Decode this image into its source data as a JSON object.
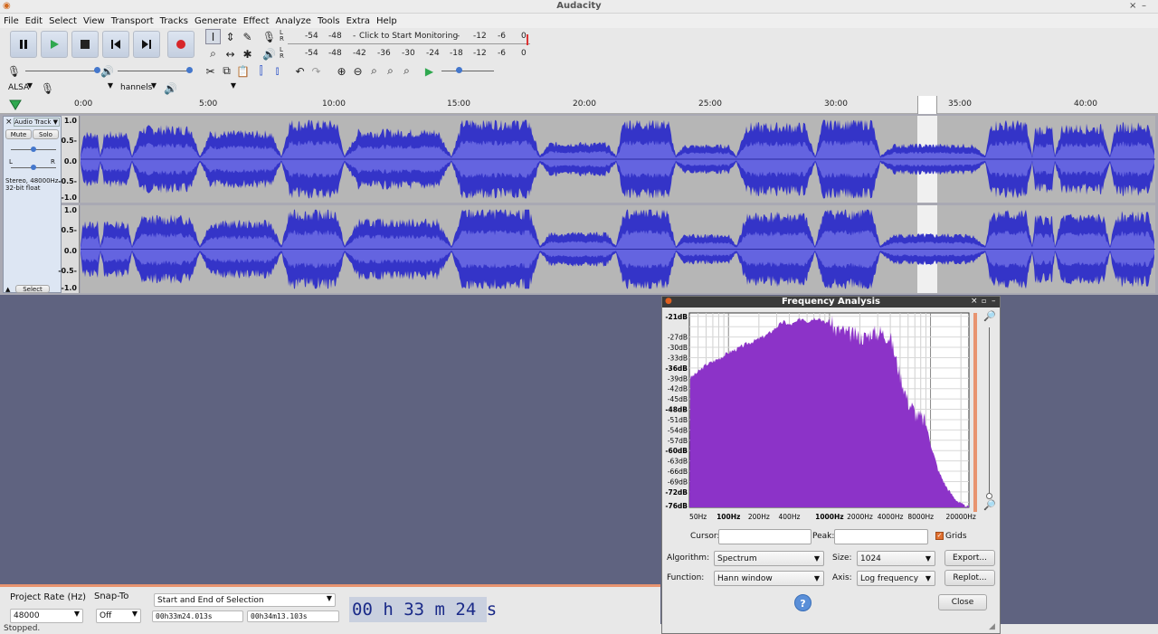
{
  "app": {
    "title": "Audacity"
  },
  "menu": [
    "File",
    "Edit",
    "Select",
    "View",
    "Transport",
    "Tracks",
    "Generate",
    "Effect",
    "Analyze",
    "Tools",
    "Extra",
    "Help"
  ],
  "meters": {
    "monitor_text": "Click to Start Monitoring",
    "rec_scale_left": [
      "-54",
      "-48"
    ],
    "rec_scale_right": [
      "-18",
      "-12",
      "-6",
      "0"
    ],
    "play_scale": [
      "-54",
      "-48",
      "-42",
      "-36",
      "-30",
      "-24",
      "-18",
      "-12",
      "-6",
      "0"
    ],
    "lr": [
      "L",
      "R"
    ]
  },
  "device": {
    "host": "ALSA",
    "mic": "",
    "channels": "hannels",
    "speaker": ""
  },
  "ruler": {
    "ticks": [
      "0:00",
      "5:00",
      "10:00",
      "15:00",
      "20:00",
      "25:00",
      "30:00",
      "35:00",
      "40:00"
    ]
  },
  "track": {
    "name": "Audio Track",
    "mute": "Mute",
    "solo": "Solo",
    "info_line1": "Stereo, 48000Hz",
    "info_line2": "32-bit float",
    "select": "Select",
    "lr_l": "L",
    "lr_r": "R",
    "scale": [
      "1.0",
      "0.5-",
      "0.0",
      "-0.5-",
      "-1.0"
    ]
  },
  "bottom": {
    "rate_label": "Project Rate (Hz)",
    "snap_label": "Snap-To",
    "rate_value": "48000",
    "snap_value": "Off",
    "selection_mode": "Start and End of Selection",
    "start_time": "00h33m24.013s",
    "end_time": "00h34m13.103s",
    "audio_position": "00 h 33 m 24 s"
  },
  "status": "Stopped.",
  "freq": {
    "title": "Frequency Analysis",
    "db_labels": [
      "-21dB",
      "-27dB",
      "-30dB",
      "-33dB",
      "-36dB",
      "-39dB",
      "-42dB",
      "-45dB",
      "-48dB",
      "-51dB",
      "-54dB",
      "-57dB",
      "-60dB",
      "-63dB",
      "-66dB",
      "-69dB",
      "-72dB",
      "-76dB"
    ],
    "hz_labels": [
      "50Hz",
      "100Hz",
      "200Hz",
      "400Hz",
      "1000Hz",
      "2000Hz",
      "4000Hz",
      "8000Hz",
      "20000Hz"
    ],
    "cursor_label": "Cursor:",
    "peak_label": "Peak:",
    "grids_label": "Grids",
    "algorithm_label": "Algorithm:",
    "algorithm_value": "Spectrum",
    "size_label": "Size:",
    "size_value": "1024",
    "function_label": "Function:",
    "function_value": "Hann window",
    "axis_label": "Axis:",
    "axis_value": "Log frequency",
    "export_label": "Export...",
    "replot_label": "Replot...",
    "close_label": "Close",
    "help_label": "?",
    "spectrum_color": "#8c33c8",
    "cursor_value": "",
    "peak_value": ""
  },
  "colors": {
    "wave": "#3434c8",
    "wave_rms": "#6464e0",
    "accent": "#e89470"
  }
}
